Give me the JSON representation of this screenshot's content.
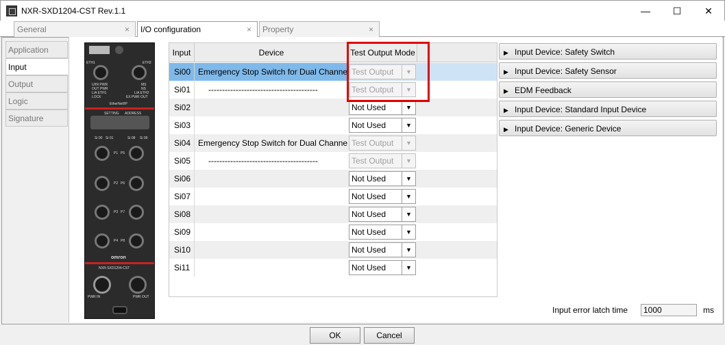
{
  "window": {
    "title": "NXR-SXD1204-CST Rev.1.1",
    "minimize": "—",
    "maximize": "☐",
    "close": "✕"
  },
  "tabs": [
    {
      "label": "General",
      "close": "×"
    },
    {
      "label": "I/O configuration",
      "close": "×"
    },
    {
      "label": "Property",
      "close": "×"
    }
  ],
  "sidebar": {
    "items": [
      "Application",
      "Input",
      "Output",
      "Logic",
      "Signature"
    ],
    "active": "Input"
  },
  "device": {
    "labels": [
      "ETH1",
      "ETH2",
      "U/IN PWR",
      "OUT PWR",
      "L/A ETH1",
      "LOCK",
      "MS",
      "NS",
      "L/A ETH2",
      "EX PWR OUT",
      "EtherNet/IP",
      "SETTING",
      "ADDRESS",
      "Si 00",
      "Si 01",
      "Si 08",
      "Si 09",
      "P1",
      "P5",
      "P2",
      "P6",
      "P3",
      "P7",
      "P4",
      "P8",
      "omron",
      "NXR-SXD1204-CST",
      "PWR IN",
      "PWR OUT"
    ]
  },
  "table": {
    "headers": [
      "Input",
      "Device",
      "Test Output Mode"
    ],
    "rows": [
      {
        "input": "Si00",
        "device": "Emergency Stop Switch for Dual Channe",
        "mode": "Test Output",
        "disabled": true,
        "selected": true
      },
      {
        "input": "Si01",
        "device": "----------------------------------------",
        "mode": "Test Output",
        "disabled": true
      },
      {
        "input": "Si02",
        "device": "",
        "mode": "Not Used",
        "disabled": false
      },
      {
        "input": "Si03",
        "device": "",
        "mode": "Not Used",
        "disabled": false
      },
      {
        "input": "Si04",
        "device": "Emergency Stop Switch for Dual Channe",
        "mode": "Test Output",
        "disabled": true
      },
      {
        "input": "Si05",
        "device": "----------------------------------------",
        "mode": "Test Output",
        "disabled": true
      },
      {
        "input": "Si06",
        "device": "",
        "mode": "Not Used",
        "disabled": false
      },
      {
        "input": "Si07",
        "device": "",
        "mode": "Not Used",
        "disabled": false
      },
      {
        "input": "Si08",
        "device": "",
        "mode": "Not Used",
        "disabled": false
      },
      {
        "input": "Si09",
        "device": "",
        "mode": "Not Used",
        "disabled": false
      },
      {
        "input": "Si10",
        "device": "",
        "mode": "Not Used",
        "disabled": false
      },
      {
        "input": "Si11",
        "device": "",
        "mode": "Not Used",
        "disabled": false
      }
    ]
  },
  "library": {
    "items": [
      "Input Device: Safety Switch",
      "Input Device: Safety Sensor",
      "EDM Feedback",
      "Input Device: Standard Input Device",
      "Input Device: Generic Device"
    ]
  },
  "latch": {
    "label": "Input error latch time",
    "value": "1000",
    "unit": "ms"
  },
  "buttons": {
    "ok": "OK",
    "cancel": "Cancel"
  },
  "colors": {
    "highlight": "#e00000",
    "selection": "#7fb9ea"
  }
}
